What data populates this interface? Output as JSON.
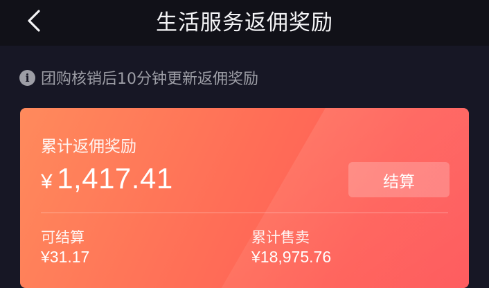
{
  "nav": {
    "back_icon": "chevron-left-icon",
    "title": "生活服务返佣奖励"
  },
  "notice": {
    "icon": "info-icon",
    "icon_glyph": "i",
    "text": "团购核销后10分钟更新返佣奖励"
  },
  "card": {
    "label": "累计返佣奖励",
    "currency": "¥",
    "amount": "1,417.41",
    "settle_label": "结算",
    "stats": [
      {
        "label": "可结算",
        "value": "¥31.17"
      },
      {
        "label": "累计售卖",
        "value": "¥18,975.76"
      }
    ],
    "gradient_colors": [
      "#ff8a5c",
      "#ff5e57"
    ]
  },
  "colors": {
    "background": "#171725",
    "nav_background": "#111118",
    "notice_text": "#9d9ea6"
  }
}
